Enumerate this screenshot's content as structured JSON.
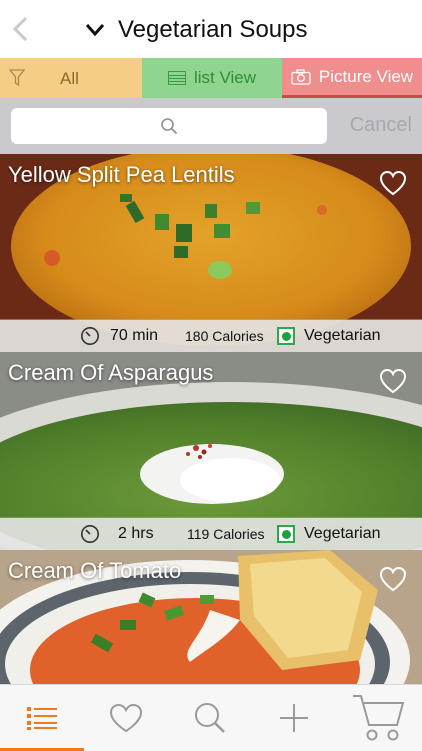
{
  "navbar": {
    "back_icon": "chevron-left-icon",
    "title": "Vegetarian Soups",
    "dropdown_icon": "chevron-down-icon"
  },
  "filters": {
    "all_label": "All",
    "list_label": "list View",
    "picture_label": "Picture View",
    "colors": {
      "all": "#f6cd86",
      "list": "#8fd48f",
      "picture": "#f08d8d"
    }
  },
  "search": {
    "placeholder": "",
    "cancel_label": "Cancel"
  },
  "recipes": [
    {
      "name": "Yellow Split Pea Lentils",
      "time": "70 min",
      "calories": "180 Calories",
      "diet": "Vegetarian"
    },
    {
      "name": "Cream Of Asparagus",
      "time": "2 hrs",
      "calories": "119 Calories",
      "diet": "Vegetarian"
    },
    {
      "name": "Cream Of Tomato",
      "time": "",
      "calories": "",
      "diet": ""
    }
  ],
  "tabbar": {
    "items": [
      "list-icon",
      "heart-icon",
      "search-icon",
      "plus-icon",
      "cart-icon"
    ],
    "active_color": "#f07a1a"
  }
}
